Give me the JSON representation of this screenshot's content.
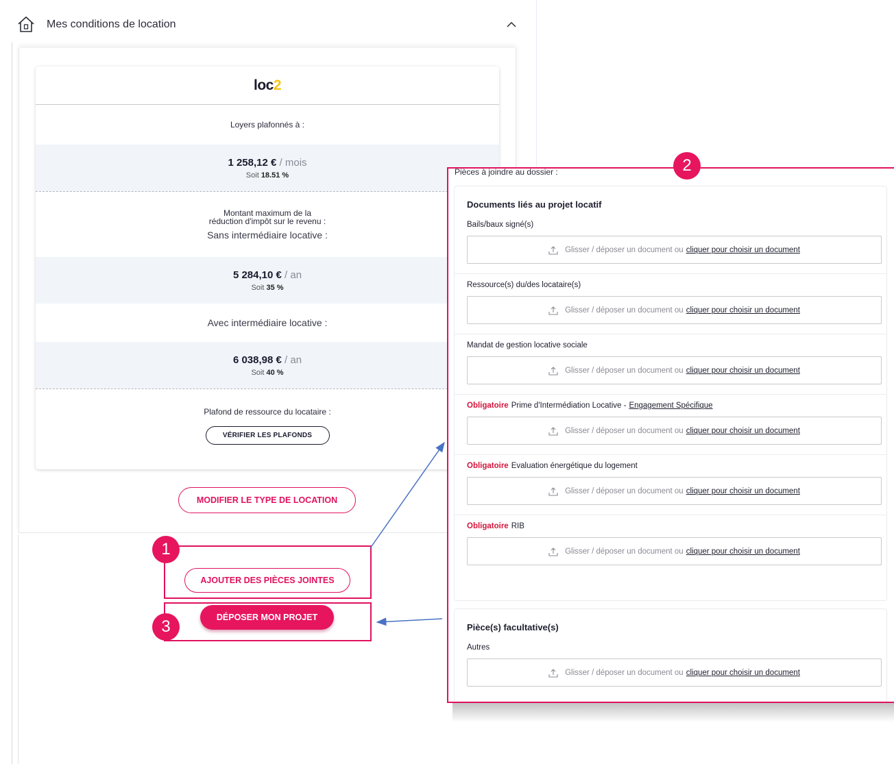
{
  "section": {
    "title": "Mes conditions de location",
    "icons": {
      "home": "home-icon",
      "toggle": "chevron-up-icon"
    }
  },
  "card": {
    "logo_text": "loc",
    "logo_number": "2",
    "rent_cap_label": "Loyers plafonnés à :",
    "rent_amount": "1 258,12 €",
    "rent_unit": " / mois",
    "rent_soit_prefix": "Soit ",
    "rent_soit_value": "18.51 %",
    "reduction_label_line1": "Montant maximum de la",
    "reduction_label_line2": "réduction d'impôt sur le revenu :",
    "without_intermediary_label": "Sans intermédiaire locative :",
    "without_amount": "5 284,10 €",
    "without_unit": " / an",
    "without_soit_prefix": "Soit ",
    "without_soit_value": "35 %",
    "with_intermediary_label": "Avec intermédiaire locative :",
    "with_amount": "6 038,98 €",
    "with_unit": " / an",
    "with_soit_prefix": "Soit ",
    "with_soit_value": "40 %",
    "ceiling_label": "Plafond de ressource du locataire :",
    "check_ceilings_button": "VÉRIFIER LES PLAFONDS"
  },
  "actions": {
    "modify_type": "MODIFIER LE TYPE DE LOCATION",
    "add_attachments": "AJOUTER DES PIÈCES JOINTES",
    "submit_project": "DÉPOSER MON PROJET"
  },
  "annotations": {
    "badge_1": "1",
    "badge_2": "2",
    "badge_3": "3",
    "highlight_color": "#e0115f",
    "arrow_color": "#4a72c4"
  },
  "attachments": {
    "title": "Pièces à joindre au dossier :",
    "dropzone_text": "Glisser / déposer un document ou",
    "dropzone_link": "cliquer pour choisir un document",
    "required_tag": "Obligatoire",
    "project_docs": {
      "title": "Documents liés au projet locatif",
      "items": [
        {
          "label": "Bails/baux signé(s)"
        },
        {
          "label": "Ressource(s) du/des locataire(s)"
        },
        {
          "label": "Mandat de gestion locative sociale"
        },
        {
          "label": "Prime d'Intermédiation Locative -",
          "link": "Engagement Spécifique"
        },
        {
          "label": "Evaluation énergétique du logement"
        },
        {
          "label": "RIB"
        }
      ]
    },
    "optional_docs": {
      "title": "Pièce(s) facultative(s)",
      "items": [
        {
          "label": "Autres"
        }
      ]
    }
  }
}
